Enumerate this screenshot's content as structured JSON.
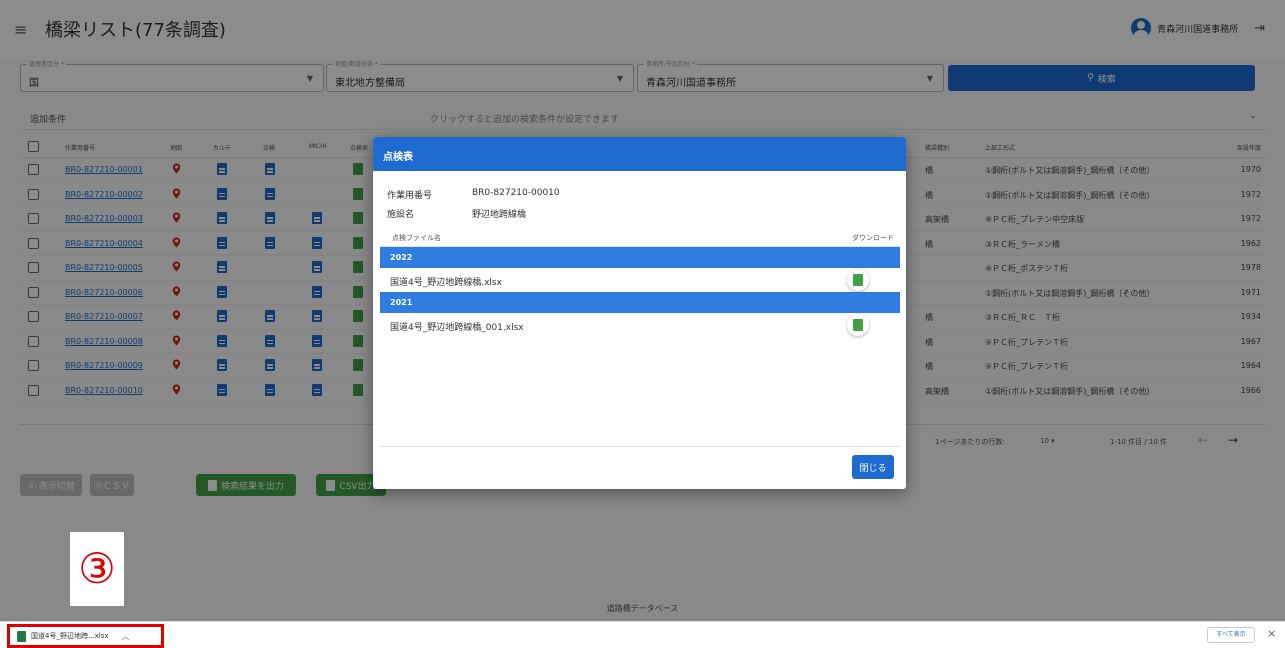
{
  "header": {
    "title": "橋梁リスト(77条調査)",
    "user": "青森河川国道事務所",
    "menu_icon": "menu-icon",
    "logout_icon": "logout-icon"
  },
  "search": {
    "field1": {
      "label": "管理者区分 *",
      "value": "国"
    },
    "field2": {
      "label": "地整/都道府県 *",
      "value": "東北地方整備局"
    },
    "field3": {
      "label": "事務所/市区町村 *",
      "value": "青森河川国道事務所"
    },
    "button": "検索"
  },
  "conditions": {
    "label": "追加条件",
    "hint": "クリックすると追加の検索条件が設定できます"
  },
  "table": {
    "headers": [
      "作業用番号",
      "地図",
      "カルテ",
      "点検",
      "MICHI",
      "点検表",
      "橋梁種別",
      "上部工形式",
      "架設年度"
    ],
    "rows": [
      {
        "id": "BR0-827210-00001",
        "type": "橋",
        "structure": "①鋼桁(ボルト又は鋼溶鋼手)_鋼桁橋（その他）",
        "year": "1970"
      },
      {
        "id": "BR0-827210-00002",
        "type": "橋",
        "structure": "①鋼桁(ボルト又は鋼溶鋼手)_鋼桁橋（その他）",
        "year": "1972"
      },
      {
        "id": "BR0-827210-00003",
        "type": "高架橋",
        "structure": "④ＰＣ桁_プレテン中空床版",
        "year": "1972"
      },
      {
        "id": "BR0-827210-00004",
        "type": "橋",
        "structure": "③ＲＣ桁_ラーメン橋",
        "year": "1962"
      },
      {
        "id": "BR0-827210-00005",
        "type": "",
        "structure": "④ＰＣ桁_ポステンＴ桁",
        "year": "1978"
      },
      {
        "id": "BR0-827210-00006",
        "type": "",
        "structure": "①鋼桁(ボルト又は鋼溶鋼手)_鋼桁橋（その他）",
        "year": "1971"
      },
      {
        "id": "BR0-827210-00007",
        "type": "橋",
        "structure": "③ＲＣ桁_ＲＣ　Ｔ桁",
        "year": "1934"
      },
      {
        "id": "BR0-827210-00008",
        "type": "橋",
        "structure": "④ＰＣ桁_プレテンＴ桁",
        "year": "1967"
      },
      {
        "id": "BR0-827210-00009",
        "type": "橋",
        "structure": "④ＰＣ桁_プレテンＴ桁",
        "year": "1964"
      },
      {
        "id": "BR0-827210-00010",
        "type": "高架橋",
        "structure": "①鋼桁(ボルト又は鋼溶鋼手)_鋼桁橋（その他）",
        "year": "1966"
      }
    ]
  },
  "pager": {
    "per_page_label": "1ページあたりの行数:",
    "per_page": "10",
    "range": "1-10 件目 / 10 件",
    "prev_icon": "arrow-left-icon",
    "next_icon": "arrow-right-icon"
  },
  "actions": {
    "btn1": "Ⓧ 表示切替",
    "btn2": "ⒹＣＳＶ",
    "export": "検索結果を出力",
    "csv": "CSV出力"
  },
  "footer": "道路橋データベース",
  "modal": {
    "title": "点検表",
    "work_no_label": "作業用番号",
    "work_no": "BR0-827210-00010",
    "facility_label": "施設名",
    "facility": "野辺地跨線橋",
    "col_file": "点検ファイル名",
    "col_download": "ダウンロード",
    "groups": [
      {
        "year": "2022",
        "file": "国道4号_野辺地跨線橋.xlsx"
      },
      {
        "year": "2021",
        "file": "国道4号_野辺地跨線橋_001.xlsx"
      }
    ],
    "close": "閉じる"
  },
  "annotation": {
    "step": "③"
  },
  "download_bar": {
    "file": "国道4号_野辺地跨...xlsx",
    "show_all": "すべて表示",
    "close": "×"
  },
  "colors": {
    "primary": "#1e6bd1",
    "excel": "#43a047",
    "highlight": "#e00000"
  }
}
